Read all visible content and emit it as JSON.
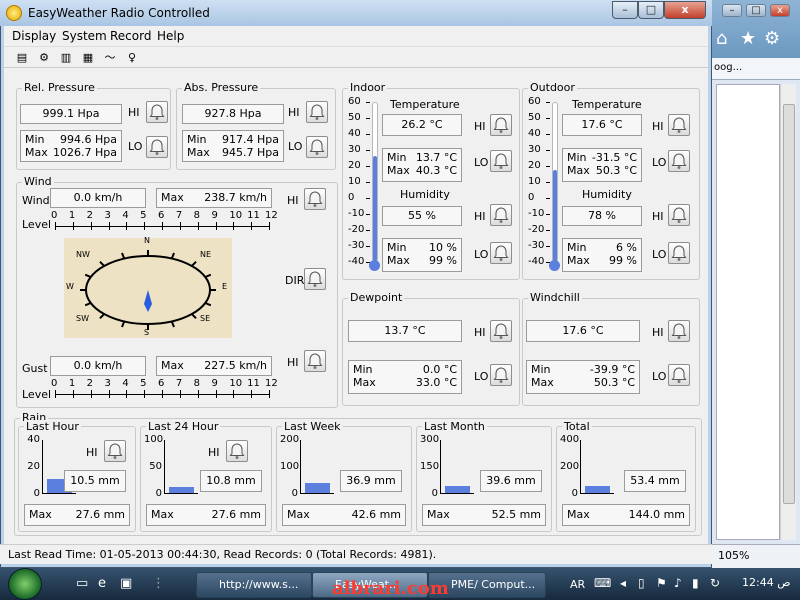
{
  "app": {
    "title": "EasyWeather Radio Controlled",
    "menus": [
      "Display",
      "System",
      "Record",
      "Help"
    ],
    "toolbar_icons": [
      "display-icon",
      "config-icon",
      "history-icon",
      "record-icon",
      "graph-icon",
      "alarm-icon"
    ]
  },
  "pressure": {
    "rel": {
      "label": "Rel. Pressure",
      "value": "999.1 Hpa",
      "min_label": "Min",
      "min": "994.6 Hpa",
      "max_label": "Max",
      "max": "1026.7 Hpa"
    },
    "abs": {
      "label": "Abs. Pressure",
      "value": "927.8 Hpa",
      "min_label": "Min",
      "min": "917.4 Hpa",
      "max_label": "Max",
      "max": "945.7 Hpa"
    }
  },
  "alarm": {
    "hi": "HI",
    "lo": "LO",
    "dir": "DIR"
  },
  "wind": {
    "label": "Wind",
    "wind_label": "Wind",
    "wind_value": "0.0 km/h",
    "max_label": "Max",
    "max_value": "238.7 km/h",
    "level_label": "Level",
    "level_ticks": [
      "0",
      "1",
      "2",
      "3",
      "4",
      "5",
      "6",
      "7",
      "8",
      "9",
      "10",
      "11",
      "12"
    ],
    "compass": [
      "N",
      "NE",
      "E",
      "SE",
      "S",
      "SW",
      "W",
      "NW"
    ],
    "gust_label": "Gust",
    "gust_value": "0.0 km/h",
    "gust_max_label": "Max",
    "gust_max": "227.5 km/h",
    "gust_level_label": "Level"
  },
  "temp_scale": [
    "60",
    "50",
    "40",
    "30",
    "20",
    "10",
    "0",
    "-10",
    "-20",
    "-30",
    "-40"
  ],
  "indoor": {
    "label": "Indoor",
    "temp_label": "Temperature",
    "temp": "26.2 °C",
    "temp_min_label": "Min",
    "temp_min": "13.7 °C",
    "temp_max_label": "Max",
    "temp_max": "40.3 °C",
    "hum_label": "Humidity",
    "hum": "55 %",
    "hum_min_label": "Min",
    "hum_min": "10 %",
    "hum_max_label": "Max",
    "hum_max": "99 %",
    "temp_level": 26.2
  },
  "outdoor": {
    "label": "Outdoor",
    "temp_label": "Temperature",
    "temp": "17.6 °C",
    "temp_min_label": "Min",
    "temp_min": "-31.5 °C",
    "temp_max_label": "Max",
    "temp_max": "50.3 °C",
    "hum_label": "Humidity",
    "hum": "78 %",
    "hum_min_label": "Min",
    "hum_min": "6 %",
    "hum_max_label": "Max",
    "hum_max": "99 %",
    "temp_level": 17.6
  },
  "dewpoint": {
    "label": "Dewpoint",
    "value": "13.7 °C",
    "min_label": "Min",
    "min": "0.0 °C",
    "max_label": "Max",
    "max": "33.0 °C"
  },
  "windchill": {
    "label": "Windchill",
    "value": "17.6 °C",
    "min_label": "Min",
    "min": "-39.9 °C",
    "max_label": "Max",
    "max": "50.3 °C"
  },
  "rain": {
    "label": "Rain",
    "last_hour": {
      "label": "Last Hour",
      "scale": [
        "40",
        "20",
        "0"
      ],
      "value": "10.5 mm",
      "max_label": "Max",
      "max": "27.6 mm",
      "level": 10.5,
      "scale_max": 40
    },
    "last_24": {
      "label": "Last 24 Hour",
      "scale": [
        "100",
        "50",
        "0"
      ],
      "value": "10.8 mm",
      "max_label": "Max",
      "max": "27.6 mm",
      "level": 10.8,
      "scale_max": 100
    },
    "last_week": {
      "label": "Last Week",
      "scale": [
        "200",
        "100",
        "0"
      ],
      "value": "36.9 mm",
      "max_label": "Max",
      "max": "42.6 mm",
      "level": 36.9,
      "scale_max": 200
    },
    "last_month": {
      "label": "Last Month",
      "scale": [
        "300",
        "150",
        "0"
      ],
      "value": "39.6 mm",
      "max_label": "Max",
      "max": "52.5 mm",
      "level": 39.6,
      "scale_max": 300
    },
    "total": {
      "label": "Total",
      "scale": [
        "400",
        "200",
        "0"
      ],
      "value": "53.4 mm",
      "max_label": "Max",
      "max": "144.0 mm",
      "level": 53.4,
      "scale_max": 400
    }
  },
  "status": {
    "text": "Last Read Time: 01-05-2013 00:44:30, Read Records: 0 (Total Records: 4981)."
  },
  "browser": {
    "tab": "oog...",
    "zoom": "105%"
  },
  "taskbar": {
    "tasks": [
      "http://www.s...",
      "EasyWeat...",
      "PME/ Comput..."
    ],
    "lang": "AR",
    "clock": "12:44",
    "clock_suffix": "ص"
  },
  "watermark": "albrari.com"
}
